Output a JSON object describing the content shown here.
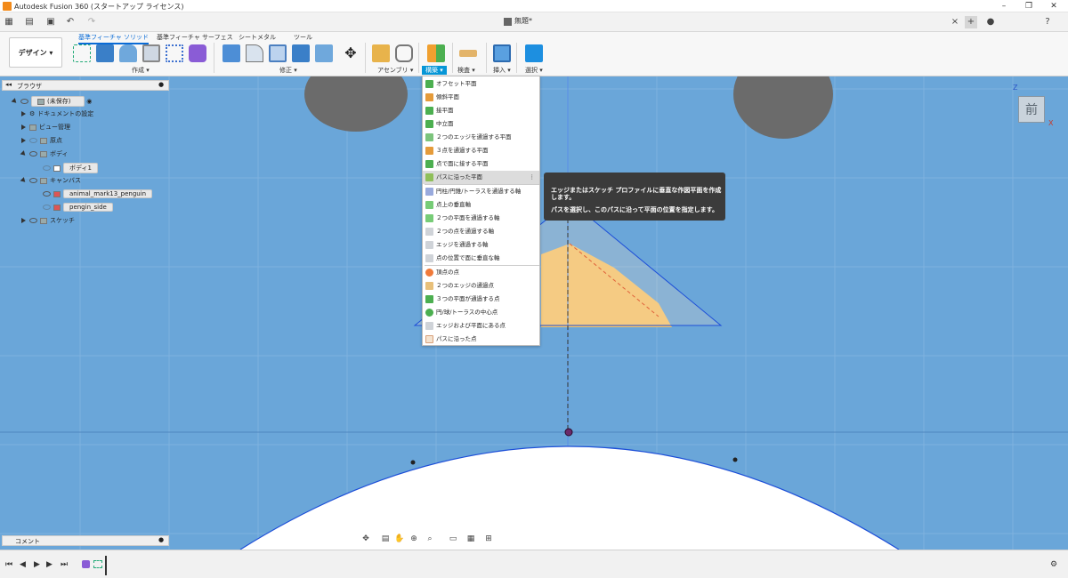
{
  "title_bar": {
    "app_title": "Autodesk Fusion 360 (スタートアップ ライセンス)"
  },
  "tab_bar": {
    "document_tab": "無題*",
    "close_label": "×",
    "add_label": "+",
    "help_label": "?"
  },
  "ribbon": {
    "workspace_button": "デザイン ▾",
    "tabs": [
      "基準フィーチャ ソリッド",
      "基準フィーチャ サーフェス",
      "シートメタル",
      "ツール"
    ],
    "groups": [
      "作成 ▾",
      "修正 ▾",
      "アセンブリ ▾",
      "構築 ▾",
      "検査 ▾",
      "挿入 ▾",
      "選択 ▾"
    ]
  },
  "browser": {
    "header": "ブラウザ",
    "items": [
      {
        "label": "(未保存)"
      },
      {
        "label": "ドキュメントの設定"
      },
      {
        "label": "ビュー管理"
      },
      {
        "label": "原点"
      },
      {
        "label": "ボディ"
      },
      {
        "label": "ボディ1"
      },
      {
        "label": "キャンバス"
      },
      {
        "label": "animal_mark13_penguin"
      },
      {
        "label": "pengin_side"
      },
      {
        "label": "スケッチ"
      }
    ]
  },
  "construct_menu": {
    "items": [
      {
        "label": "オフセット平面",
        "icon": "offset-plane-icon"
      },
      {
        "label": "傾斜平面",
        "icon": "angle-plane-icon"
      },
      {
        "label": "接平面",
        "icon": "tangent-plane-icon"
      },
      {
        "label": "中立面",
        "icon": "midplane-icon"
      },
      {
        "label": "２つのエッジを通過する平面",
        "icon": "plane-two-edges-icon"
      },
      {
        "label": "３点を通過する平面",
        "icon": "plane-three-points-icon"
      },
      {
        "label": "点で面に接する平面",
        "icon": "plane-tangent-point-icon"
      },
      {
        "label": "パスに沿った平面",
        "icon": "plane-along-path-icon"
      },
      {
        "label": "円柱/円錐/トーラスを通過する軸",
        "icon": "axis-cylinder-icon"
      },
      {
        "label": "点上の垂直軸",
        "icon": "axis-perp-point-icon"
      },
      {
        "label": "２つの平面を通過する軸",
        "icon": "axis-two-planes-icon"
      },
      {
        "label": "２つの点を通過する軸",
        "icon": "axis-two-points-icon"
      },
      {
        "label": "エッジを通過する軸",
        "icon": "axis-edge-icon"
      },
      {
        "label": "点の位置で面に垂直な軸",
        "icon": "axis-perp-face-icon"
      },
      {
        "label": "頂点の点",
        "icon": "point-vertex-icon"
      },
      {
        "label": "２つのエッジの通過点",
        "icon": "point-two-edges-icon"
      },
      {
        "label": "３つの平面が通過する点",
        "icon": "point-three-planes-icon"
      },
      {
        "label": "円/球/トーラスの中心点",
        "icon": "point-center-icon"
      },
      {
        "label": "エッジおよび平面にある点",
        "icon": "point-edge-plane-icon"
      },
      {
        "label": "パスに沿った点",
        "icon": "point-along-path-icon"
      }
    ],
    "highlighted_item": "パスに沿った平面"
  },
  "tooltip": {
    "line1": "エッジまたはスケッチ プロファイルに垂直な作図平面を作成",
    "line2": "します。",
    "line3": "パスを選択し、このパスに沿って平面の位置を指定します。"
  },
  "viewcube": {
    "face_label": "前",
    "axis_z": "Z",
    "axis_x": "X"
  },
  "comment_panel": {
    "label": "コメント"
  },
  "colors": {
    "canvas_blue": "#6aa6d9",
    "accent": "#0696d7",
    "penguin_gray": "#6b6b6b",
    "beak_orange": "#f7c66c",
    "sketch_line": "#1d4fd8"
  }
}
